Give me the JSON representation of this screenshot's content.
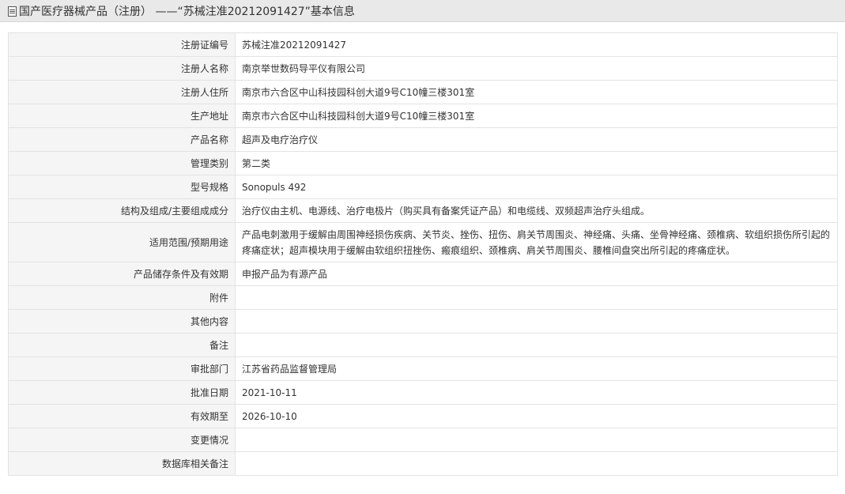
{
  "header": {
    "title": "国产医疗器械产品（注册） ——“苏械注准20212091427”基本信息"
  },
  "rows": [
    {
      "label": "注册证编号",
      "value": "苏械注准20212091427"
    },
    {
      "label": "注册人名称",
      "value": "南京举世数码导平仪有限公司"
    },
    {
      "label": "注册人住所",
      "value": "南京市六合区中山科技园科创大道9号C10幢三楼301室"
    },
    {
      "label": "生产地址",
      "value": "南京市六合区中山科技园科创大道9号C10幢三楼301室"
    },
    {
      "label": "产品名称",
      "value": "超声及电疗治疗仪"
    },
    {
      "label": "管理类别",
      "value": "第二类"
    },
    {
      "label": "型号规格",
      "value": "Sonopuls 492"
    },
    {
      "label": "结构及组成/主要组成成分",
      "value": "治疗仪由主机、电源线、治疗电极片（购买具有备案凭证产品）和电缆线、双频超声治疗头组成。"
    },
    {
      "label": "适用范围/预期用途",
      "value": "产品电刺激用于缓解由周围神经损伤疾病、关节炎、挫伤、扭伤、肩关节周围炎、神经痛、头痛、坐骨神经痛、颈椎病、软组织损伤所引起的疼痛症状；超声模块用于缓解由软组织扭挫伤、瘢痕组织、颈椎病、肩关节周围炎、腰椎间盘突出所引起的疼痛症状。"
    },
    {
      "label": "产品储存条件及有效期",
      "value": "申报产品为有源产品"
    },
    {
      "label": "附件",
      "value": ""
    },
    {
      "label": "其他内容",
      "value": ""
    },
    {
      "label": "备注",
      "value": ""
    },
    {
      "label": "审批部门",
      "value": "江苏省药品监督管理局"
    },
    {
      "label": "批准日期",
      "value": "2021-10-11"
    },
    {
      "label": "有效期至",
      "value": "2026-10-10"
    },
    {
      "label": "变更情况",
      "value": ""
    },
    {
      "label": "数据库相关备注",
      "value": ""
    }
  ]
}
